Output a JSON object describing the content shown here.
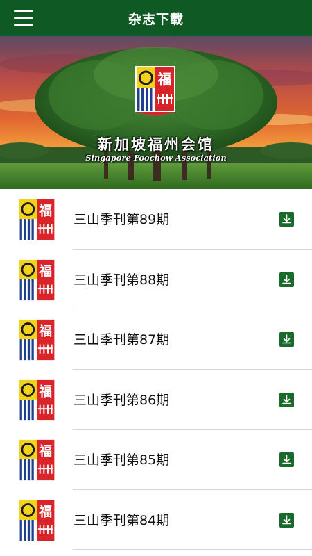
{
  "header": {
    "title": "杂志下载",
    "menu_icon": "hamburger-menu-icon",
    "background": "#0f5a24"
  },
  "banner": {
    "name_cn": "新加坡福州会馆",
    "name_en": "Singapore Foochow Association",
    "logo_icon": "association-emblem-icon",
    "logo_char": "福"
  },
  "magazines": [
    {
      "title": "三山季刊第89期",
      "icon": "download-icon"
    },
    {
      "title": "三山季刊第88期",
      "icon": "download-icon"
    },
    {
      "title": "三山季刊第87期",
      "icon": "download-icon"
    },
    {
      "title": "三山季刊第86期",
      "icon": "download-icon"
    },
    {
      "title": "三山季刊第85期",
      "icon": "download-icon"
    },
    {
      "title": "三山季刊第84期",
      "icon": "download-icon"
    }
  ],
  "colors": {
    "accent": "#0f5a24",
    "download_button": "#1a6a2c",
    "emblem_red": "#d9242a",
    "emblem_yellow": "#f2d21b",
    "emblem_blue": "#1f3f8f"
  }
}
